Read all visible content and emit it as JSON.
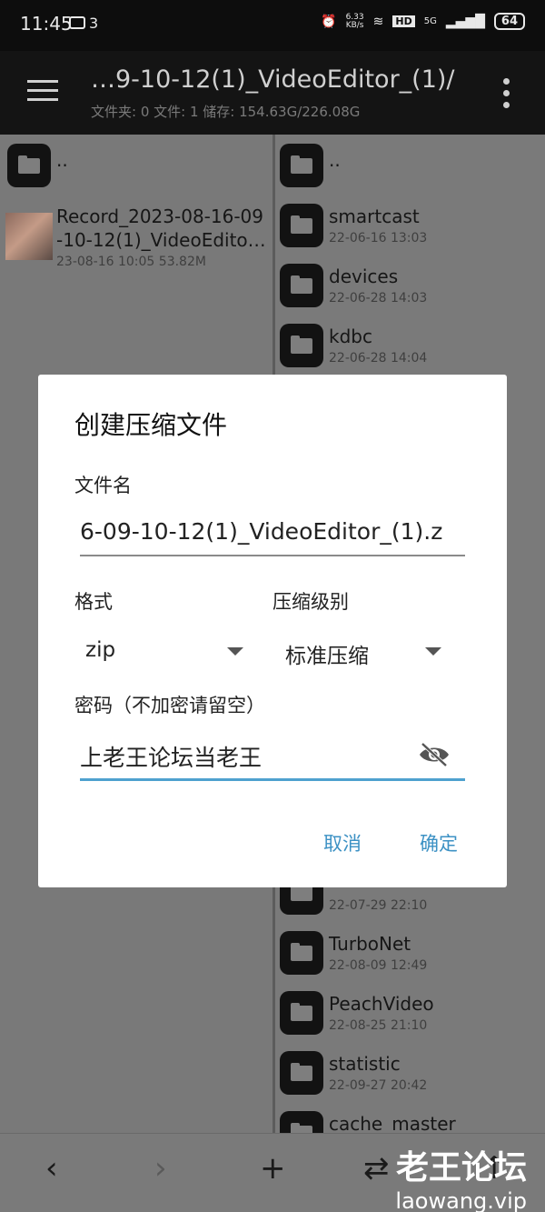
{
  "status_bar": {
    "time": "11:45",
    "notification_count": "3",
    "net_speed": "6.33",
    "net_unit": "KB/s",
    "hd": "HD",
    "signal": "5G",
    "battery": "64"
  },
  "app_bar": {
    "path": "…9-10-12(1)_VideoEditor_(1)/",
    "info": "文件夹: 0  文件: 1  储存: 154.63G/226.08G"
  },
  "left_pane": {
    "parent": "..",
    "file": {
      "name_line1": "Record_2023-08-16-09",
      "name_line2": "-10-12(1)_VideoEdito…",
      "meta": "23-08-16 10:05  53.82M"
    }
  },
  "right_pane": {
    "items": [
      {
        "name": "..",
        "date": ""
      },
      {
        "name": "smartcast",
        "date": "22-06-16 13:03"
      },
      {
        "name": "devices",
        "date": "22-06-28 14:03"
      },
      {
        "name": "kdbc",
        "date": "22-06-28 14:04"
      },
      {
        "name": "",
        "date": "22-07-29 22:10"
      },
      {
        "name": "TurboNet",
        "date": "22-08-09 12:49"
      },
      {
        "name": "PeachVideo",
        "date": "22-08-25 21:10"
      },
      {
        "name": "statistic",
        "date": "22-09-27 20:42"
      },
      {
        "name": "cache_master",
        "date": ""
      }
    ]
  },
  "toolbar": {
    "back": "‹",
    "forward": "›",
    "add": "+",
    "swap": "⇄",
    "up": "↑"
  },
  "dialog": {
    "title": "创建压缩文件",
    "filename_label": "文件名",
    "filename_value": "6-09-10-12(1)_VideoEditor_(1).z",
    "format_label": "格式",
    "format_value": "zip",
    "level_label": "压缩级别",
    "level_value": "标准压缩",
    "password_label": "密码（不加密请留空）",
    "password_value": "上老王论坛当老王",
    "cancel": "取消",
    "confirm": "确定"
  },
  "watermark": {
    "cn": "老王论坛",
    "en": "laowang.vip"
  },
  "colors": {
    "accent": "#4ea1cf",
    "button_text": "#3c91c4",
    "scrim": "#7a7a7a"
  }
}
